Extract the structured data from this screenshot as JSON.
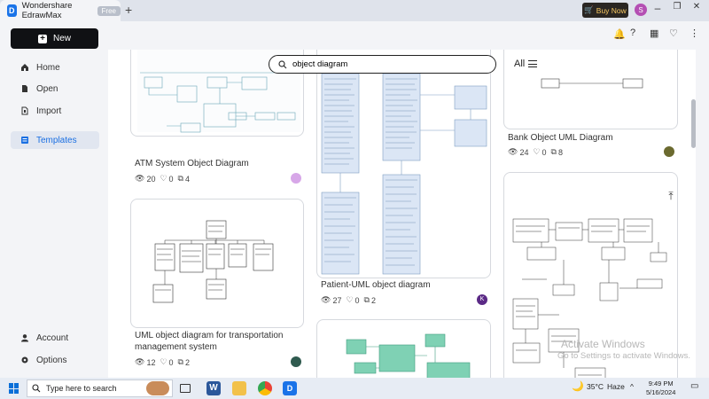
{
  "titlebar": {
    "app_name": "Wondershare EdrawMax",
    "badge": "Free",
    "new_tab": "+",
    "buy_now": "Buy Now",
    "user_initial": "S",
    "minimize": "–",
    "maximize": "❐",
    "close": "✕"
  },
  "sidebar": {
    "new_label": "New",
    "items": [
      {
        "label": "Home",
        "icon": "home-icon"
      },
      {
        "label": "Open",
        "icon": "file-icon"
      },
      {
        "label": "Import",
        "icon": "import-icon"
      },
      {
        "label": "Templates",
        "icon": "templates-icon",
        "active": true
      }
    ],
    "bottom": [
      {
        "label": "Account",
        "icon": "user-icon"
      },
      {
        "label": "Options",
        "icon": "gear-icon"
      }
    ]
  },
  "search": {
    "value": "object diagram",
    "placeholder": "Search"
  },
  "filter": {
    "label": "All"
  },
  "templates": [
    {
      "title": "ATM System Object Diagram",
      "views": "20",
      "likes": "0",
      "copies": "4",
      "author_color": "#d7a7e8"
    },
    {
      "title": "Patient-UML object diagram",
      "views": "27",
      "likes": "0",
      "copies": "2",
      "author_initial": "K",
      "author_color": "#5b2a86"
    },
    {
      "title": "Bank Object UML Diagram",
      "views": "24",
      "likes": "0",
      "copies": "8",
      "author_color": "#6b6a2f"
    },
    {
      "title": "UML object diagram for transportation management system",
      "views": "12",
      "likes": "0",
      "copies": "2",
      "author_color": "#2f5a4f"
    }
  ],
  "watermark": {
    "line1": "Activate Windows",
    "line2": "Go to Settings to activate Windows."
  },
  "taskbar": {
    "search_placeholder": "Type here to search",
    "weather_temp": "35°C",
    "weather_desc": "Haze",
    "time": "9:49 PM",
    "date": "5/16/2024"
  },
  "colors": {
    "accent": "#1a6fe2",
    "buy_now_bg": "#2a2622",
    "buy_now_text": "#f6c863"
  }
}
